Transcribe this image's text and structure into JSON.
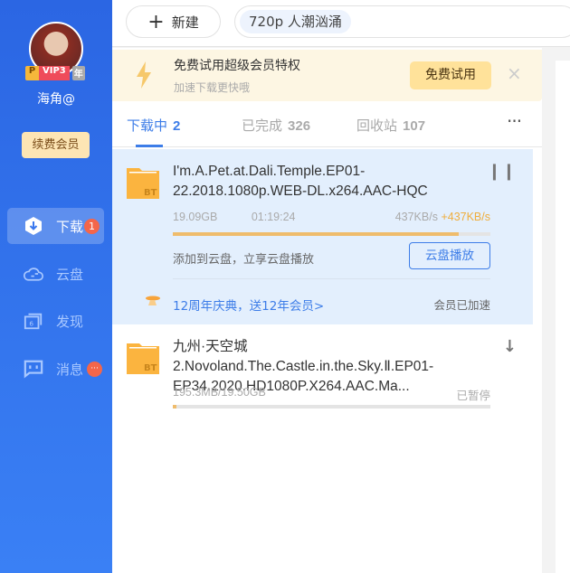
{
  "sidebar": {
    "username": "海角@",
    "vip": {
      "p": "P",
      "level": "VIP3",
      "year": "年"
    },
    "renew_label": "续费会员",
    "items": [
      {
        "label": "下载",
        "icon": "download-icon",
        "badge": "1",
        "active": true
      },
      {
        "label": "云盘",
        "icon": "cloud-icon"
      },
      {
        "label": "发现",
        "icon": "discover-icon"
      },
      {
        "label": "消息",
        "icon": "message-icon",
        "badge": "···"
      }
    ]
  },
  "toolbar": {
    "new_label": "新建",
    "search_chip": "720p  人潮汹涌"
  },
  "banner": {
    "title": "免费试用超级会员特权",
    "subtitle": "加速下载更快哦",
    "trial_label": "免费试用",
    "close": "×"
  },
  "tabs": [
    {
      "label": "下载中",
      "count": "2"
    },
    {
      "label": "已完成",
      "count": "326"
    },
    {
      "label": "回收站",
      "count": "107"
    }
  ],
  "more": "···",
  "downloads": [
    {
      "name": "I'm.A.Pet.at.Dali.Temple.EP01-22.2018.1080p.WEB-DL.x264.AAC-HQC",
      "size": "19.09GB",
      "time": "01:19:24",
      "speed": "437KB/s",
      "boost": "+437KB/s",
      "progress": 0.9,
      "cloud_text": "添加到云盘，立享云盘播放",
      "cloud_button": "云盘播放",
      "promo": "12周年庆典，送12年会员>",
      "accel": "会员已加速",
      "action": "pause-icon",
      "badge": "BT"
    },
    {
      "name": "九州·天空城2.Novoland.The.Castle.in.the.Sky.Ⅱ.EP01-EP34.2020.HD1080P.X264.AAC.Ma...",
      "size": "195.3MB/19.50GB",
      "status": "已暂停",
      "progress": 0.01,
      "action": "download-icon",
      "badge": "BT"
    }
  ],
  "colors": {
    "accent": "#3d7de8",
    "progress": "#efbc6c",
    "sidebar": "#2e6be6"
  }
}
